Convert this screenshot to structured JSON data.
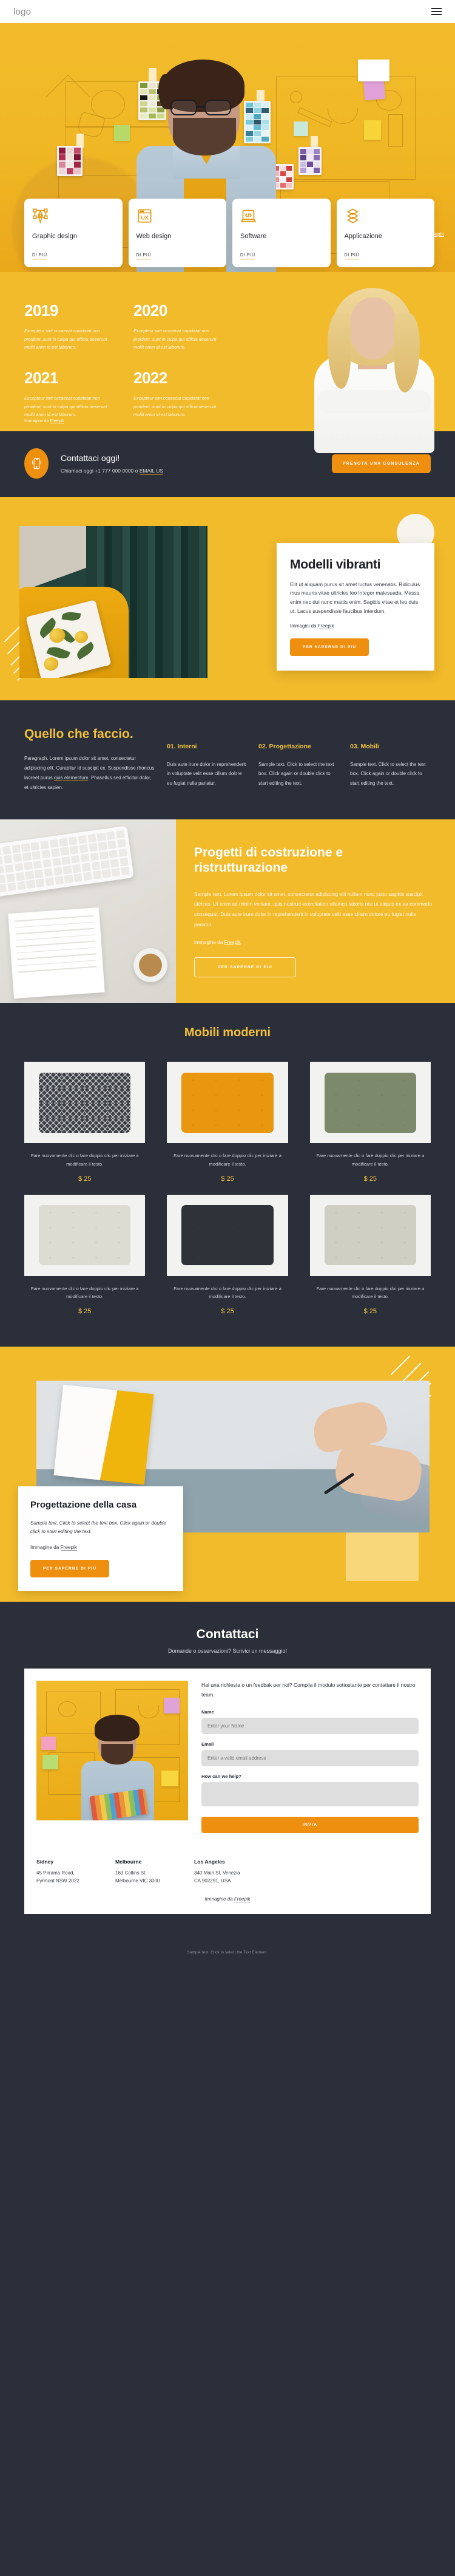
{
  "header": {
    "logo": "logo",
    "menu_icon": "hamburger-menu-icon"
  },
  "hero": {
    "credit_prefix": "Immagine di ",
    "credit_link": "Freepik",
    "cards": [
      {
        "icon": "pen-tool-icon",
        "title": "Graphic design",
        "link": "DI PIÙ"
      },
      {
        "icon": "ux-browser-icon",
        "title": "Web design",
        "link": "DI PIÙ"
      },
      {
        "icon": "code-laptop-icon",
        "title": "Software",
        "link": "DI PIÙ"
      },
      {
        "icon": "layers-stack-icon",
        "title": "Applicazione",
        "link": "DI PIÙ"
      }
    ]
  },
  "years": {
    "items": [
      {
        "year": "2019",
        "text": "Excepteur sint occaecat cupidatat non proident, sunt in culpa qui officia deserunt mollit anim id est laborum."
      },
      {
        "year": "2020",
        "text": "Excepteur sint occaecat cupidatat non proident, sunt in culpa qui officia deserunt mollit anim id est laborum."
      },
      {
        "year": "2021",
        "text": "Excepteur sint occaecat cupidatat non proident, sunt in culpa qui officia deserunt mollit anim id est laborum."
      },
      {
        "year": "2022",
        "text": "Excepteur sint occaecat cupidatat non proident, sunt in culpa qui officia deserunt mollit anim id est laborum."
      }
    ],
    "credit_prefix": "Immagine da ",
    "credit_link": "Freepik"
  },
  "contact_strip": {
    "icon": "mobile-phone-ringing-icon",
    "title": "Contattaci oggi!",
    "subtitle_prefix": "Chiamaci oggi +1 777 000 0000 o ",
    "subtitle_link": "EMAIL US",
    "button": "PRENOTA UNA CONSULENZA"
  },
  "vibrant": {
    "title": "Modelli vibranti",
    "body": "Elit ut aliquam purus sit amet luctus venenatis. Ridiculus mus mauris vitae ultricies leo integer malesuada. Massa enim nec dui nunc mattis enim. Sagittis vitae et leo duis ut. Lacus suspendisse faucibus interdum.",
    "credit_prefix": "Immagini da ",
    "credit_link": "Freepik",
    "button": "PER SAPERNE DI PIÙ"
  },
  "faccio": {
    "title": "Quello che faccio.",
    "paragraph_a": "Paragraph. Lorem ipsum dolor sit amet, consectetur adipiscing elit. Curabitur id suscipit ex. Suspendisse rhoncus laoreet purus ",
    "paragraph_link": "quis elementum",
    "paragraph_b": ". Phasellus sed efficitur dolor, et ultricies sapien.",
    "columns": [
      {
        "heading": "01. Interni",
        "text": "Duis aute irure dolor in reprehenderit in voluptate velit esse cillum dolore eu fugiat nulla pariatur."
      },
      {
        "heading": "02. Progettazione",
        "text": "Sample text. Click to select the text box. Click again or double click to start editing the text."
      },
      {
        "heading": "03. Mobili",
        "text": "Sample text. Click to select the text box. Click again or double click to start editing the text."
      }
    ]
  },
  "progetti": {
    "title": "Progetti di costruzione e ristrutturazione",
    "body": "Sample text. Lorem ipsum dolor sit amet, consectetur adipiscing elit nullam nunc justo sagittis suscipit ultrices. Ut enim ad minim veniam, quis nostrud exercitation ullamco laboris nisi ut aliquip ex ea commodo consequat. Duis aute irure dolor in reprehenderit in voluptate velit esse cillum dolore eu fugiat nulla pariatur.",
    "credit_prefix": "Immagine da ",
    "credit_link": "Freepik",
    "button": "PER SAPERNE DI PIÙ"
  },
  "mobili": {
    "title": "Mobili moderni",
    "products": [
      {
        "color": "#3e4248",
        "pattern": "diamond",
        "text": "Fare nuovamente clic o fare doppio clic per iniziare a modificare il testo.",
        "price": "$ 25"
      },
      {
        "color": "#e8970f",
        "pattern": "tufted",
        "text": "Fare nuovamente clic o fare doppio clic per iniziare a modificare il testo.",
        "price": "$ 25"
      },
      {
        "color": "#7c8a6b",
        "pattern": "tufted",
        "text": "Fare nuovamente clic o fare doppio clic per iniziare a modificare il testo.",
        "price": "$ 25"
      },
      {
        "color": "#dcdcd2",
        "pattern": "plain",
        "text": "Fare nuovamente clic o fare doppio clic per iniziare a modificare il testo.",
        "price": "$ 25"
      },
      {
        "color": "#2f3238",
        "pattern": "tufted",
        "text": "Fare nuovamente clic o fare doppio clic per iniziare a modificare il testo.",
        "price": "$ 25"
      },
      {
        "color": "#cfcfc3",
        "pattern": "tufted",
        "text": "Fare nuovamente clic o fare doppio clic per iniziare a modificare il testo.",
        "price": "$ 25"
      }
    ]
  },
  "casa": {
    "title": "Progettazione della casa",
    "body": "Sample text. Click to select the text box. Click again or double click to start editing the text.",
    "credit_prefix": "Immagine da ",
    "credit_link": "Freepik",
    "button": "PER SAPERNE DI PIÙ"
  },
  "contatti": {
    "title": "Contattaci",
    "subtitle": "Domande o osservazioni? Scrivici un messaggio!",
    "lead": "Hai una richiesta o un feedbak per noi? Compila il modulo sottostante per contattare il nostro team.",
    "fields": [
      {
        "label": "Name",
        "placeholder": "Enter your Name",
        "value": ""
      },
      {
        "label": "Email",
        "placeholder": "Enter a valid email address",
        "value": ""
      },
      {
        "label": "How can we help?",
        "placeholder": "",
        "value": ""
      }
    ],
    "submit": "INVIA",
    "addresses": [
      {
        "city": "Sidney",
        "line1": "45 Pirrama Road,",
        "line2": "Pyrmont NSW 2022"
      },
      {
        "city": "Melbourne",
        "line1": "163 Collins St,",
        "line2": "Melbourne VIC 3000"
      },
      {
        "city": "Los Angeles",
        "line1": "340 Main St, Venezia",
        "line2": "CA 902291, USA"
      }
    ],
    "credit_prefix": "Immagine da ",
    "credit_link": "Freepik"
  },
  "footer": {
    "text": "Sample text. Click to select the Text Element."
  },
  "colors": {
    "yellow": "#f2bb2c",
    "orange": "#ef8f10",
    "dark": "#2b2f3a",
    "gold": "#f2c13c"
  }
}
